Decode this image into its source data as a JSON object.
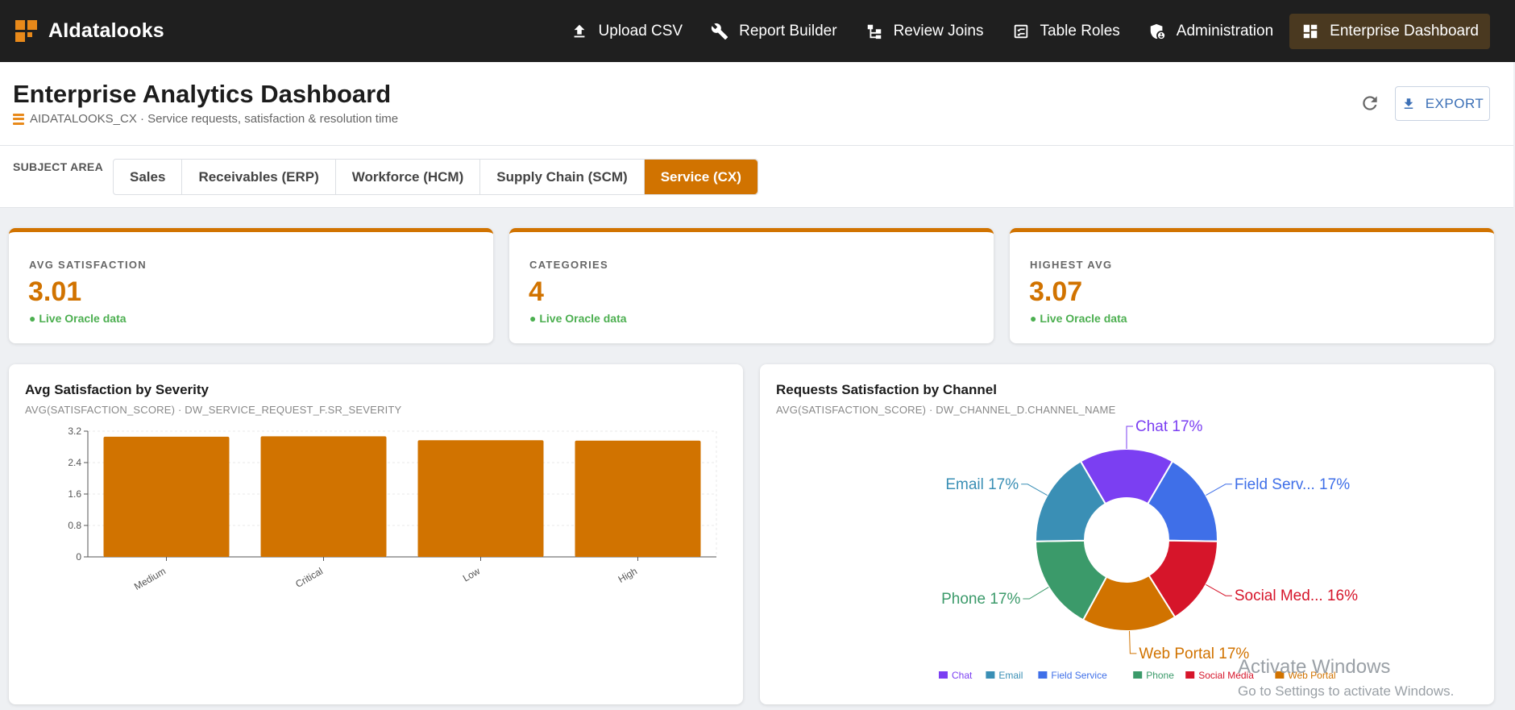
{
  "app": {
    "name": "AIdatalooks",
    "nav": [
      {
        "label": "Upload CSV",
        "icon": "upload-icon"
      },
      {
        "label": "Report Builder",
        "icon": "wrench-icon"
      },
      {
        "label": "Review Joins",
        "icon": "joins-icon"
      },
      {
        "label": "Table Roles",
        "icon": "checklist-icon"
      },
      {
        "label": "Administration",
        "icon": "admin-shield-icon"
      },
      {
        "label": "Enterprise Dashboard",
        "icon": "dashboard-icon",
        "active": true
      }
    ]
  },
  "header": {
    "title": "Enterprise Analytics Dashboard",
    "subtitle": "AIDATALOOKS_CX · Service requests, satisfaction & resolution time",
    "export_label": "EXPORT"
  },
  "subject_area": {
    "label": "SUBJECT AREA",
    "tabs": [
      "Sales",
      "Receivables (ERP)",
      "Workforce (HCM)",
      "Supply Chain (SCM)",
      "Service (CX)"
    ],
    "active": "Service (CX)"
  },
  "kpis": [
    {
      "label": "AVG SATISFACTION",
      "value": "3.01",
      "status": "● Live Oracle data"
    },
    {
      "label": "CATEGORIES",
      "value": "4",
      "status": "● Live Oracle data"
    },
    {
      "label": "HIGHEST AVG",
      "value": "3.07",
      "status": "● Live Oracle data"
    }
  ],
  "charts": {
    "severity": {
      "title": "Avg Satisfaction by Severity",
      "subtitle": "AVG(SATISFACTION_SCORE) · DW_SERVICE_REQUEST_F.SR_SEVERITY"
    },
    "channel": {
      "title": "Requests Satisfaction by Channel",
      "subtitle": "AVG(SATISFACTION_SCORE) · DW_CHANNEL_D.CHANNEL_NAME"
    }
  },
  "chart_data": [
    {
      "type": "bar",
      "categories": [
        "Medium",
        "Critical",
        "Low",
        "High"
      ],
      "values": [
        3.06,
        3.07,
        2.97,
        2.96
      ],
      "ylim": [
        0,
        3.2
      ],
      "yticks": [
        "0",
        "0.8",
        "1.6",
        "2.4",
        "3.2"
      ],
      "color": "#d17300",
      "grid": true
    },
    {
      "type": "pie",
      "donut": true,
      "slices": [
        {
          "name": "Chat",
          "label": "Chat 17%",
          "value": 17,
          "color": "#7b3ff2"
        },
        {
          "name": "Field Service",
          "label": "Field Serv... 17%",
          "value": 17,
          "color": "#3f6fe8"
        },
        {
          "name": "Social Media",
          "label": "Social Med... 16%",
          "value": 16,
          "color": "#d6152a"
        },
        {
          "name": "Web Portal",
          "label": "Web Portal 17%",
          "value": 17,
          "color": "#d17300"
        },
        {
          "name": "Phone",
          "label": "Phone 17%",
          "value": 17,
          "color": "#3b9a6a"
        },
        {
          "name": "Email",
          "label": "Email 17%",
          "value": 17,
          "color": "#3a8fb5"
        }
      ],
      "legend": [
        "Chat",
        "Email",
        "Field Service",
        "Phone",
        "Social Media",
        "Web Portal"
      ],
      "legend_colors": [
        "#7b3ff2",
        "#3a8fb5",
        "#3f6fe8",
        "#3b9a6a",
        "#d6152a",
        "#d17300"
      ],
      "legend_position": "bottom"
    }
  ],
  "watermark": {
    "line1": "Activate Windows",
    "line2": "Go to Settings to activate Windows."
  }
}
